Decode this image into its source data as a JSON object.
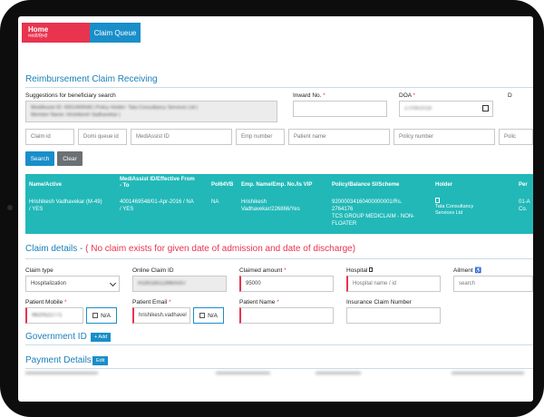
{
  "nav": {
    "home_label": "Home",
    "home_sub": "मराठी/हिन्दी",
    "queue_label": "Claim Queue"
  },
  "page": {
    "title": "Reimbursement Claim Receiving"
  },
  "suggest": {
    "label": "Suggestions for beneficiary search",
    "line1": "MediAssist ID: 4001469548 | Policy Holder: Tata Consultancy Services Ltd |",
    "line2": "Member Name: Hrishikesh Vadhavekar |"
  },
  "inward": {
    "label": "Inward No.",
    "required": "*"
  },
  "doa": {
    "label": "DOA",
    "required": "*",
    "value": "27/09/2016"
  },
  "dod": {
    "label": "D"
  },
  "search_fields": {
    "claim_id": "Claim id",
    "domi_queue_id": "Domi queue id",
    "mediassist_id": "MediAssist ID",
    "emp_number": "Emp number",
    "patient_name": "Patient name",
    "policy_number": "Policy number",
    "policy_cut": "Polic"
  },
  "buttons": {
    "search": "Search",
    "clear": "Clear",
    "add": "+ Add",
    "edit": "Edit"
  },
  "table": {
    "headers": {
      "name": "Name/Active",
      "mediassist_line1": "MediAssist ID/Effective From",
      "mediassist_line2": "- To",
      "pol64vb": "Pol64VB",
      "emp": "Emp. Name/Emp. No./Is VIP",
      "policy": "Policy/Balance SI/Scheme",
      "holder": "Holder",
      "per": "Per"
    },
    "row": {
      "name_line1": "Hrishikesh Vadhavekar (M-49)",
      "name_line2": "/ YES",
      "mediassist": "4001469548/01-Apr-2016 / NA",
      "mediassist_line2": "/ YES",
      "pol64vb": "NA",
      "emp_line1": "Hrishikesh",
      "emp_line2": "Vadhavekar/226866/Yes",
      "policy_line1": "92000034160400000001/Rs.",
      "policy_line2": "2764176",
      "policy_line3": "TCS GROUP MEDICLAIM - NON-",
      "policy_line4": "FLOATER",
      "holder_line1": "Tata Consultancy",
      "holder_line2": "Services Ltd",
      "per_line1": "01-A",
      "per_line2": "Co."
    }
  },
  "claim": {
    "title": "Claim details - ",
    "warning": "( No claim exists for given date of admission and date of discharge)"
  },
  "form": {
    "claim_type": {
      "label": "Claim type",
      "value": "Hospitalization"
    },
    "online_claim_id": {
      "label": "Online Claim ID",
      "value": "H19016022M6A007"
    },
    "claimed_amount": {
      "label": "Claimed amount",
      "required": "*",
      "value": "95000"
    },
    "hospital": {
      "label": "Hospital",
      "placeholder": "Hospital name / id"
    },
    "ailment": {
      "label": "Ailment",
      "placeholder": "search"
    },
    "patient_mobile": {
      "label": "Patient Mobile",
      "required": "*",
      "value": "9820522771"
    },
    "patient_email": {
      "label": "Patient Email",
      "required": "*",
      "value": "hrishikesh.vadhavel"
    },
    "patient_name": {
      "label": "Patient Name",
      "required": "*"
    },
    "insurance_claim_number": {
      "label": "Insurance Claim Number"
    },
    "na_label": "N/A"
  },
  "gov": {
    "title": "Government ID"
  },
  "payment": {
    "title": "Payment Details"
  },
  "colors": {
    "accent": "#1a8ec9",
    "brand_red": "#e8344f",
    "table_teal": "#22b8b8"
  }
}
